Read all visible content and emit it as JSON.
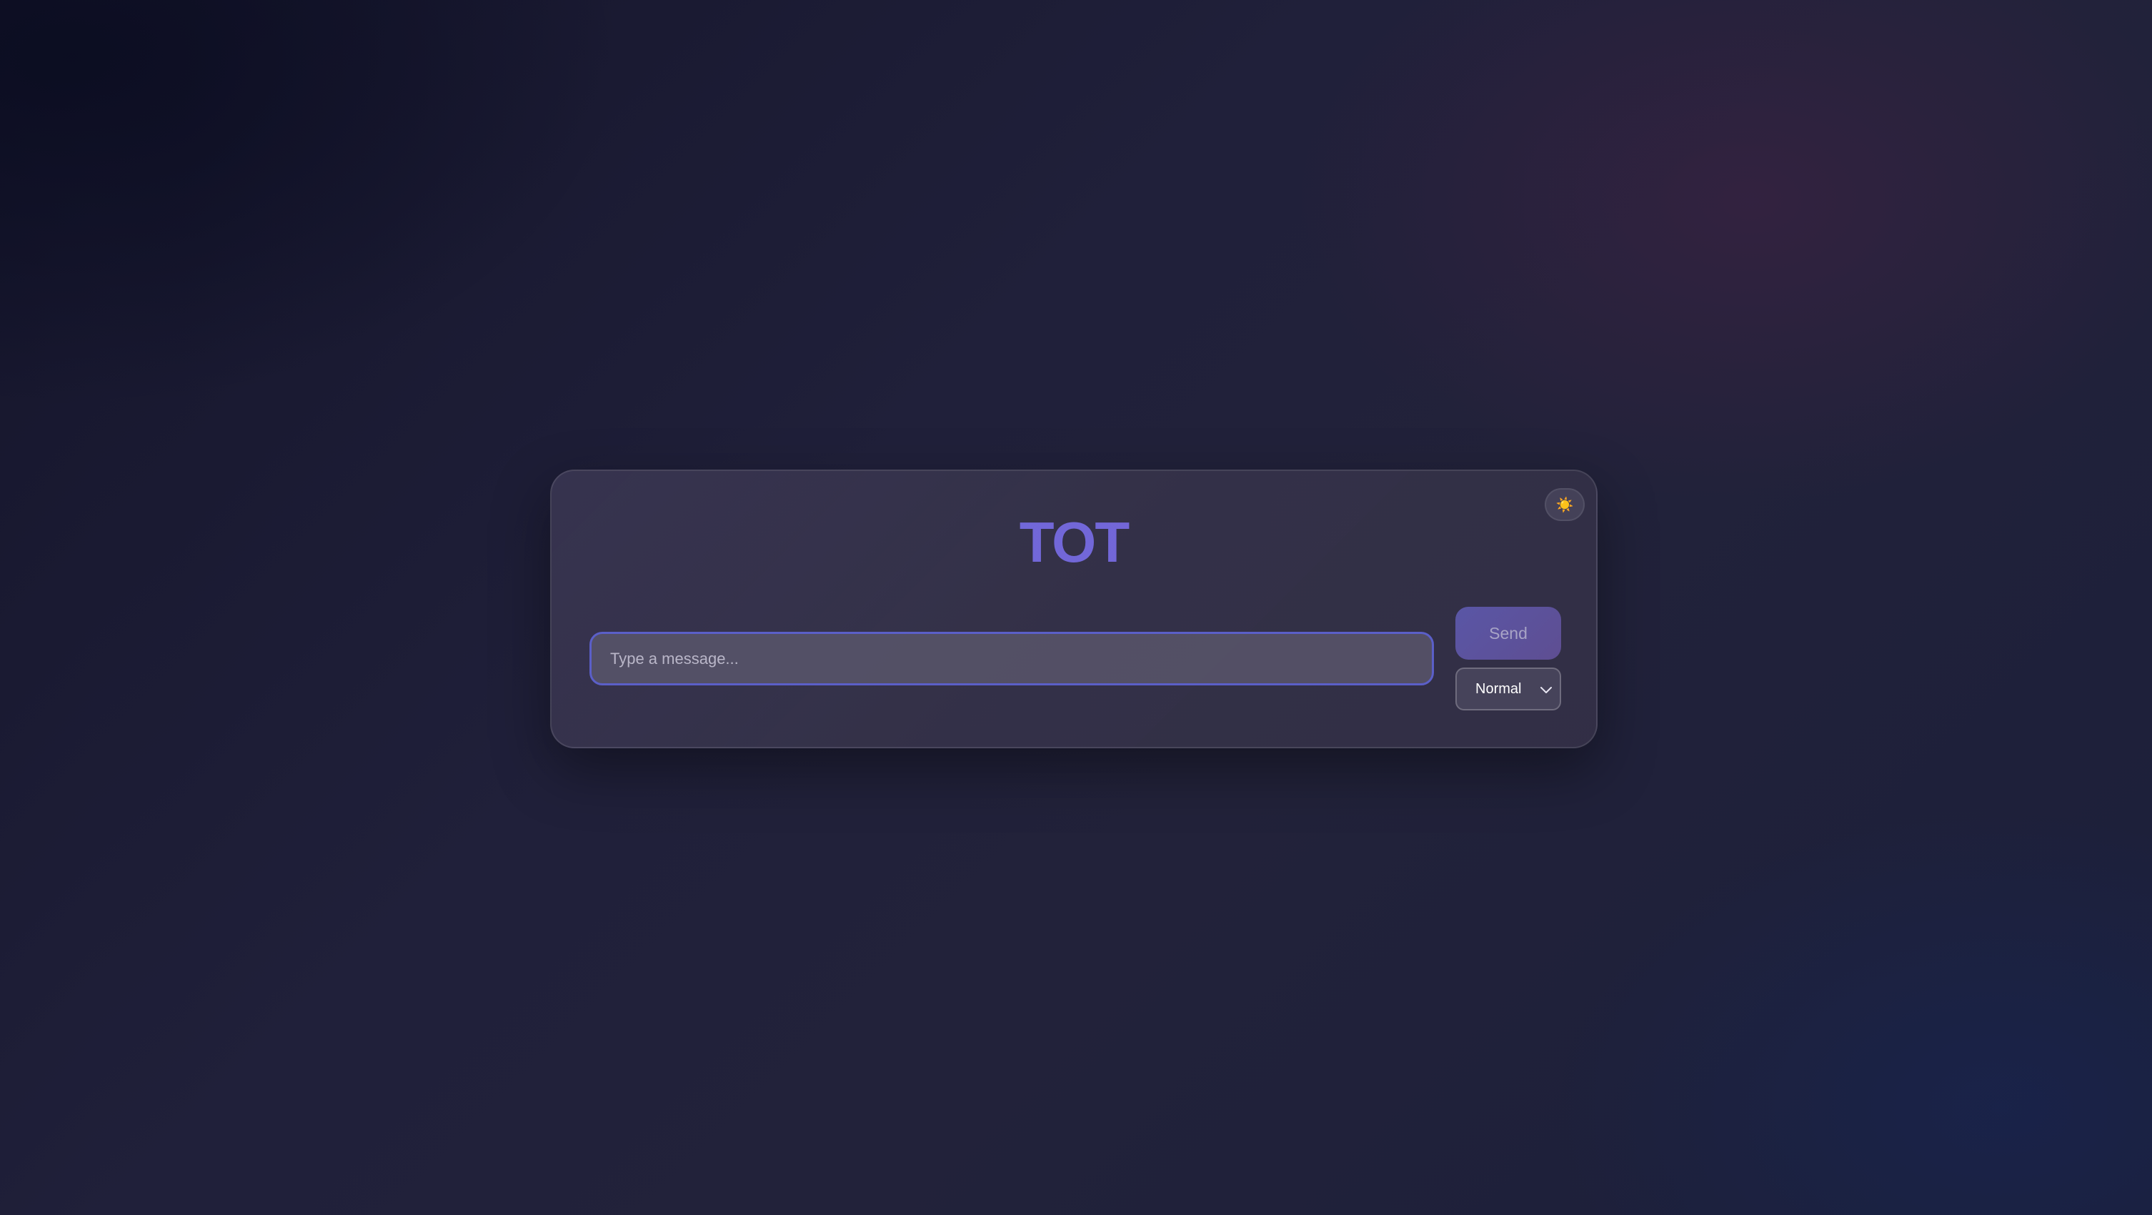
{
  "app": {
    "title": "TOT"
  },
  "theme_toggle": {
    "icon": "sun-icon",
    "glyph": "☀️"
  },
  "composer": {
    "placeholder": "Type a message...",
    "value": "",
    "send_label": "Send",
    "mode_selected": "Normal"
  },
  "colors": {
    "accent": "#6e64d6",
    "input_border": "#5b5fc8",
    "send_bg": "#5a56a6"
  }
}
